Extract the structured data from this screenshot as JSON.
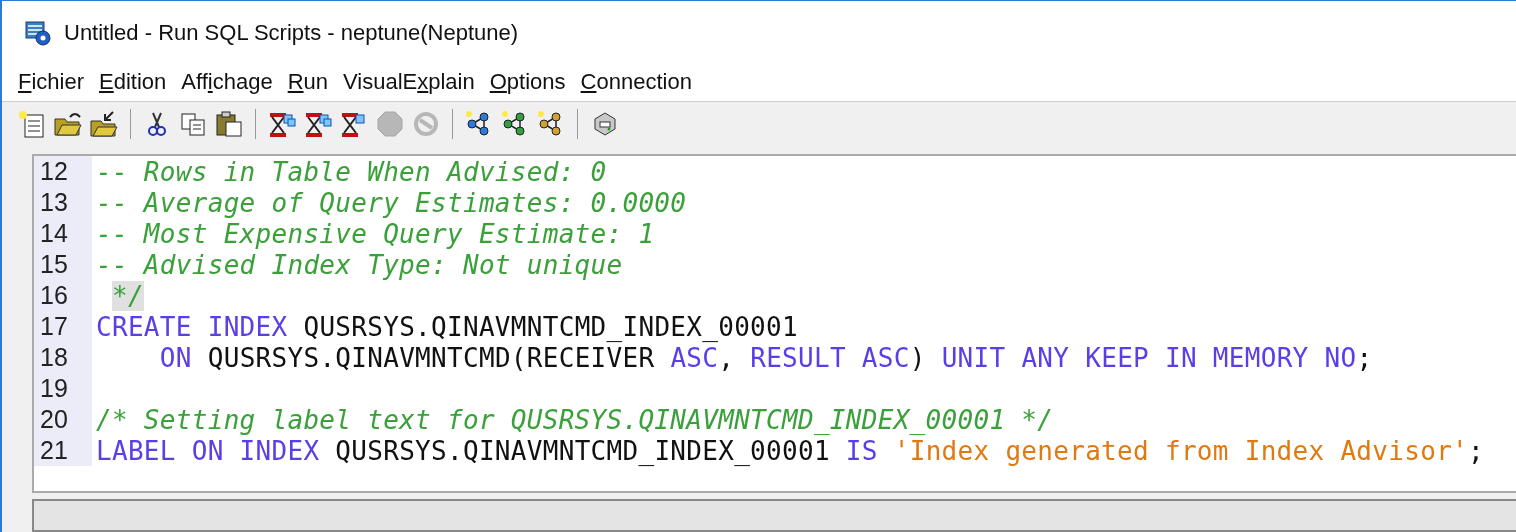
{
  "window": {
    "title": "Untitled - Run SQL Scripts - neptune(Neptune)"
  },
  "menu": [
    {
      "key": "F",
      "after": "ichier"
    },
    {
      "key": "E",
      "after": "dition"
    },
    {
      "before": "Aff",
      "key": "i",
      "after": "chage"
    },
    {
      "key": "R",
      "after": "un"
    },
    {
      "before": "VisualE",
      "key": "x",
      "after": "plain"
    },
    {
      "key": "O",
      "after": "ptions"
    },
    {
      "key": "C",
      "after": "onnection"
    }
  ],
  "toolbar": [
    {
      "kind": "new",
      "disabled": false
    },
    {
      "kind": "open",
      "disabled": false
    },
    {
      "kind": "import",
      "disabled": false
    },
    {
      "kind": "separator"
    },
    {
      "kind": "cut",
      "disabled": false
    },
    {
      "kind": "copy",
      "disabled": false
    },
    {
      "kind": "paste",
      "disabled": false
    },
    {
      "kind": "separator"
    },
    {
      "kind": "run-all",
      "disabled": false
    },
    {
      "kind": "run-selected",
      "disabled": false
    },
    {
      "kind": "run-from",
      "disabled": false
    },
    {
      "kind": "stop",
      "disabled": true
    },
    {
      "kind": "cancel",
      "disabled": true
    },
    {
      "kind": "separator"
    },
    {
      "kind": "explain",
      "disabled": false
    },
    {
      "kind": "explain-run",
      "disabled": false
    },
    {
      "kind": "explain-results",
      "disabled": false
    },
    {
      "kind": "separator"
    },
    {
      "kind": "print",
      "disabled": false
    }
  ],
  "editor": {
    "lines": [
      {
        "number": "12",
        "tokens": [
          {
            "kind": "comment",
            "text": "-- Rows in Table When Advised: 0",
            "highlighted": false
          }
        ]
      },
      {
        "number": "13",
        "tokens": [
          {
            "kind": "comment",
            "text": "-- Average of Query Estimates: 0.0000",
            "highlighted": false
          }
        ]
      },
      {
        "number": "14",
        "tokens": [
          {
            "kind": "comment",
            "text": "-- Most Expensive Query Estimate: 1",
            "highlighted": false
          }
        ]
      },
      {
        "number": "15",
        "tokens": [
          {
            "kind": "comment",
            "text": "-- Advised Index Type: Not unique",
            "highlighted": false
          }
        ]
      },
      {
        "number": "16",
        "tokens": [
          {
            "kind": "comment",
            "text": " */",
            "highlighted": true
          }
        ]
      },
      {
        "number": "17",
        "tokens": [
          {
            "kind": "keyword",
            "text": "CREATE INDEX",
            "highlighted": false
          },
          {
            "kind": "plain",
            "text": " QUSRSYS.QINAVMNTCMD_INDEX_00001",
            "highlighted": false
          }
        ]
      },
      {
        "number": "18",
        "tokens": [
          {
            "kind": "keyword",
            "text": "    ON",
            "highlighted": false
          },
          {
            "kind": "plain",
            "text": " QUSRSYS.QINAVMNTCMD(RECEIVER ",
            "highlighted": false
          },
          {
            "kind": "keyword",
            "text": "ASC",
            "highlighted": false
          },
          {
            "kind": "plain",
            "text": ", ",
            "highlighted": false
          },
          {
            "kind": "keyword",
            "text": "RESULT ASC",
            "highlighted": false
          },
          {
            "kind": "plain",
            "text": ") ",
            "highlighted": false
          },
          {
            "kind": "keyword",
            "text": "UNIT ANY KEEP IN MEMORY NO",
            "highlighted": false
          },
          {
            "kind": "plain",
            "text": ";",
            "highlighted": false
          }
        ]
      },
      {
        "number": "19"
      },
      {
        "number": "20",
        "tokens": [
          {
            "kind": "comment",
            "text": "/* Setting label text for QUSRSYS.QINAVMNTCMD_INDEX_00001 */",
            "highlighted": false
          }
        ]
      },
      {
        "number": "21",
        "tokens": [
          {
            "kind": "keyword",
            "text": "LABEL ON INDEX",
            "highlighted": false
          },
          {
            "kind": "plain",
            "text": " QUSRSYS.QINAVMNTCMD_INDEX_00001 ",
            "highlighted": false
          },
          {
            "kind": "keyword",
            "text": "IS ",
            "highlighted": false
          },
          {
            "kind": "string",
            "text": "'Index generated from Index Advisor'",
            "highlighted": false
          },
          {
            "kind": "plain",
            "text": ";",
            "highlighted": false
          }
        ]
      }
    ]
  }
}
